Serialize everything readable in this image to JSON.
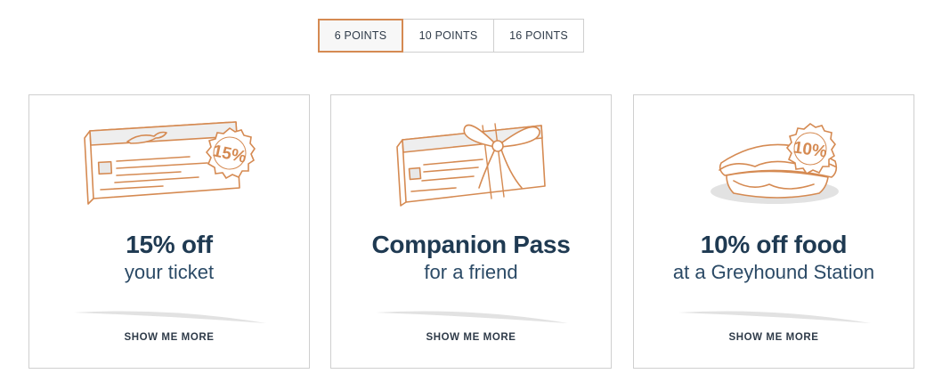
{
  "tabs": [
    {
      "label": "6 POINTS",
      "selected": true
    },
    {
      "label": "10 POINTS",
      "selected": false
    },
    {
      "label": "16 POINTS",
      "selected": false
    }
  ],
  "accent_color": "#d58a52",
  "title_color": "#1f3a52",
  "cards": [
    {
      "title": "15% off",
      "subtitle": "your ticket",
      "cta": "SHOW ME MORE",
      "icon": "ticket-discount-icon",
      "badge": "15%"
    },
    {
      "title": "Companion Pass",
      "subtitle": "for a friend",
      "cta": "SHOW ME MORE",
      "icon": "gift-ticket-icon"
    },
    {
      "title": "10% off food",
      "subtitle": "at a Greyhound Station",
      "cta": "SHOW ME MORE",
      "icon": "sandwich-discount-icon",
      "badge": "10%"
    }
  ]
}
